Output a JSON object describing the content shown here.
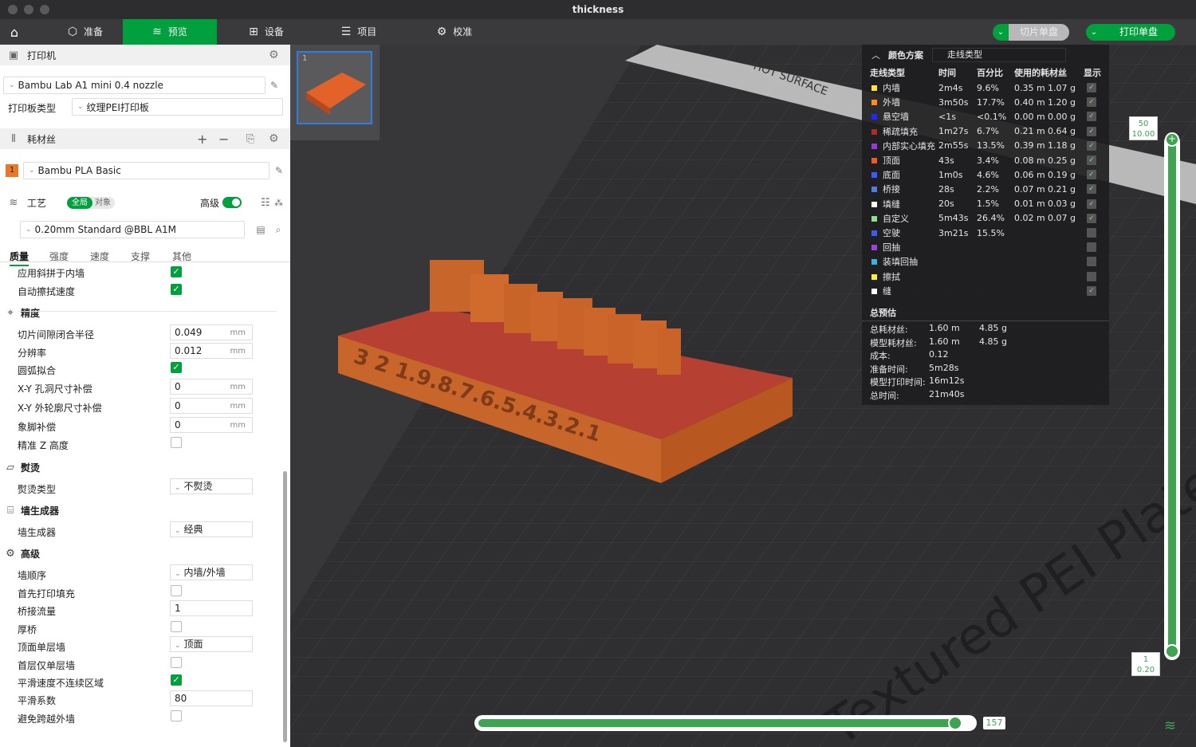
{
  "window": {
    "title": "thickness"
  },
  "tabs": [
    {
      "label": "准备",
      "icon": "cube-icon"
    },
    {
      "label": "预览",
      "icon": "layers-icon"
    },
    {
      "label": "设备",
      "icon": "device-icon"
    },
    {
      "label": "项目",
      "icon": "list-icon"
    },
    {
      "label": "校准",
      "icon": "calibrate-icon"
    }
  ],
  "actions": {
    "slice_label": "切片单盘",
    "print_label": "打印单盘"
  },
  "printer": {
    "section_title": "打印机",
    "name": "Bambu Lab A1 mini 0.4 nozzle",
    "plate_label": "打印板类型",
    "plate_value": "纹理PEI打印板"
  },
  "filament": {
    "section_title": "耗材丝",
    "slot": "1",
    "name": "Bambu PLA Basic",
    "color": "#e8792b"
  },
  "process": {
    "section_title": "工艺",
    "toggle_global": "全局",
    "toggle_object": "对象",
    "advanced_label": "高级",
    "profile": "0.20mm Standard @BBL A1M",
    "tabs": [
      "质量",
      "强度",
      "速度",
      "支撑",
      "其他"
    ]
  },
  "settings": {
    "top": [
      {
        "label": "应用斜拼于内墙",
        "checked": true
      },
      {
        "label": "自动擦拭速度",
        "checked": true
      }
    ],
    "precision": {
      "title": "精度",
      "rows": [
        {
          "label": "切片间隙闭合半径",
          "value": "0.049",
          "unit": "mm"
        },
        {
          "label": "分辨率",
          "value": "0.012",
          "unit": "mm"
        },
        {
          "label": "圆弧拟合",
          "checked": true
        },
        {
          "label": "X-Y 孔洞尺寸补偿",
          "value": "0",
          "unit": "mm"
        },
        {
          "label": "X-Y 外轮廓尺寸补偿",
          "value": "0",
          "unit": "mm"
        },
        {
          "label": "象脚补偿",
          "value": "0",
          "unit": "mm"
        },
        {
          "label": "精准 Z 高度",
          "checked": false
        }
      ]
    },
    "ironing": {
      "title": "熨烫",
      "type_label": "熨烫类型",
      "type_value": "不熨烫"
    },
    "wall_gen": {
      "title": "墙生成器",
      "label": "墙生成器",
      "value": "经典"
    },
    "advanced": {
      "title": "高级",
      "rows": [
        {
          "label": "墙顺序",
          "value": "内墙/外墙",
          "dropdown": true
        },
        {
          "label": "首先打印填充",
          "checked": false
        },
        {
          "label": "桥接流量",
          "value": "1"
        },
        {
          "label": "厚桥",
          "checked": false
        },
        {
          "label": "顶面单层墙",
          "value": "顶面",
          "dropdown": true
        },
        {
          "label": "首层仅单层墙",
          "checked": false
        },
        {
          "label": "平滑速度不连续区域",
          "checked": true
        },
        {
          "label": "平滑系数",
          "value": "80"
        },
        {
          "label": "避免跨越外墙",
          "checked": false
        }
      ]
    }
  },
  "legend": {
    "scheme_label": "颜色方案",
    "scheme_value": "走线类型",
    "headers": [
      "走线类型",
      "时间",
      "百分比",
      "使用的耗材丝",
      "显示"
    ],
    "rows": [
      {
        "color": "#ffe43b",
        "name": "内墙",
        "time": "2m4s",
        "pct": "9.6%",
        "len": "0.35 m",
        "wt": "1.07 g",
        "shown": true
      },
      {
        "color": "#ff8c1a",
        "name": "外墙",
        "time": "3m50s",
        "pct": "17.7%",
        "len": "0.40 m",
        "wt": "1.20 g",
        "shown": true
      },
      {
        "color": "#1f2aff",
        "name": "悬空墙",
        "time": "<1s",
        "pct": "<0.1%",
        "len": "0.00 m",
        "wt": "0.00 g",
        "shown": true
      },
      {
        "color": "#b02a2a",
        "name": "稀疏填充",
        "time": "1m27s",
        "pct": "6.7%",
        "len": "0.21 m",
        "wt": "0.64 g",
        "shown": true
      },
      {
        "color": "#9a3ad6",
        "name": "内部实心填充",
        "time": "2m55s",
        "pct": "13.5%",
        "len": "0.39 m",
        "wt": "1.18 g",
        "shown": true
      },
      {
        "color": "#f05a28",
        "name": "顶面",
        "time": "43s",
        "pct": "3.4%",
        "len": "0.08 m",
        "wt": "0.25 g",
        "shown": true
      },
      {
        "color": "#3b5bff",
        "name": "底面",
        "time": "1m0s",
        "pct": "4.6%",
        "len": "0.06 m",
        "wt": "0.19 g",
        "shown": true
      },
      {
        "color": "#4d7fd6",
        "name": "桥接",
        "time": "28s",
        "pct": "2.2%",
        "len": "0.07 m",
        "wt": "0.21 g",
        "shown": true
      },
      {
        "color": "#ffffff",
        "name": "填缝",
        "time": "20s",
        "pct": "1.5%",
        "len": "0.01 m",
        "wt": "0.03 g",
        "shown": true
      },
      {
        "color": "#8ee08e",
        "name": "自定义",
        "time": "5m43s",
        "pct": "26.4%",
        "len": "0.02 m",
        "wt": "0.07 g",
        "shown": true
      },
      {
        "color": "#3c5cf0",
        "name": "空驶",
        "time": "3m21s",
        "pct": "15.5%",
        "len": "",
        "wt": "",
        "shown": false
      },
      {
        "color": "#a040e0",
        "name": "回抽",
        "time": "",
        "pct": "",
        "len": "",
        "wt": "",
        "shown": false
      },
      {
        "color": "#3fb0e0",
        "name": "装填回抽",
        "time": "",
        "pct": "",
        "len": "",
        "wt": "",
        "shown": false
      },
      {
        "color": "#ffee33",
        "name": "擦拭",
        "time": "",
        "pct": "",
        "len": "",
        "wt": "",
        "shown": false
      },
      {
        "color": "#ffffff",
        "name": "缝",
        "time": "",
        "pct": "",
        "len": "",
        "wt": "",
        "shown": true
      }
    ],
    "summary_title": "总预估",
    "summary": [
      {
        "label": "总耗材丝:",
        "v1": "1.60 m",
        "v2": "4.85 g"
      },
      {
        "label": "模型耗材丝:",
        "v1": "1.60 m",
        "v2": "4.85 g"
      },
      {
        "label": "成本:",
        "v1": "0.12",
        "v2": ""
      },
      {
        "label": "准备时间:",
        "v1": "5m28s",
        "v2": ""
      },
      {
        "label": "模型打印时间:",
        "v1": "16m12s",
        "v2": ""
      },
      {
        "label": "总时间:",
        "v1": "21m40s",
        "v2": ""
      }
    ]
  },
  "viewport": {
    "plate_text": "Textured PEI Plate",
    "hot_surface": "HOT SURFACE",
    "model_numbers": "3 2 1.9.8.7.6.5.4.3.2.1",
    "plate_index": "1"
  },
  "sliders": {
    "horizontal_value": "157",
    "horizontal_progress": 0.98,
    "vertical_top_layer": "50",
    "vertical_top_height": "10.00",
    "vertical_bottom_layer": "1",
    "vertical_bottom_height": "0.20"
  }
}
